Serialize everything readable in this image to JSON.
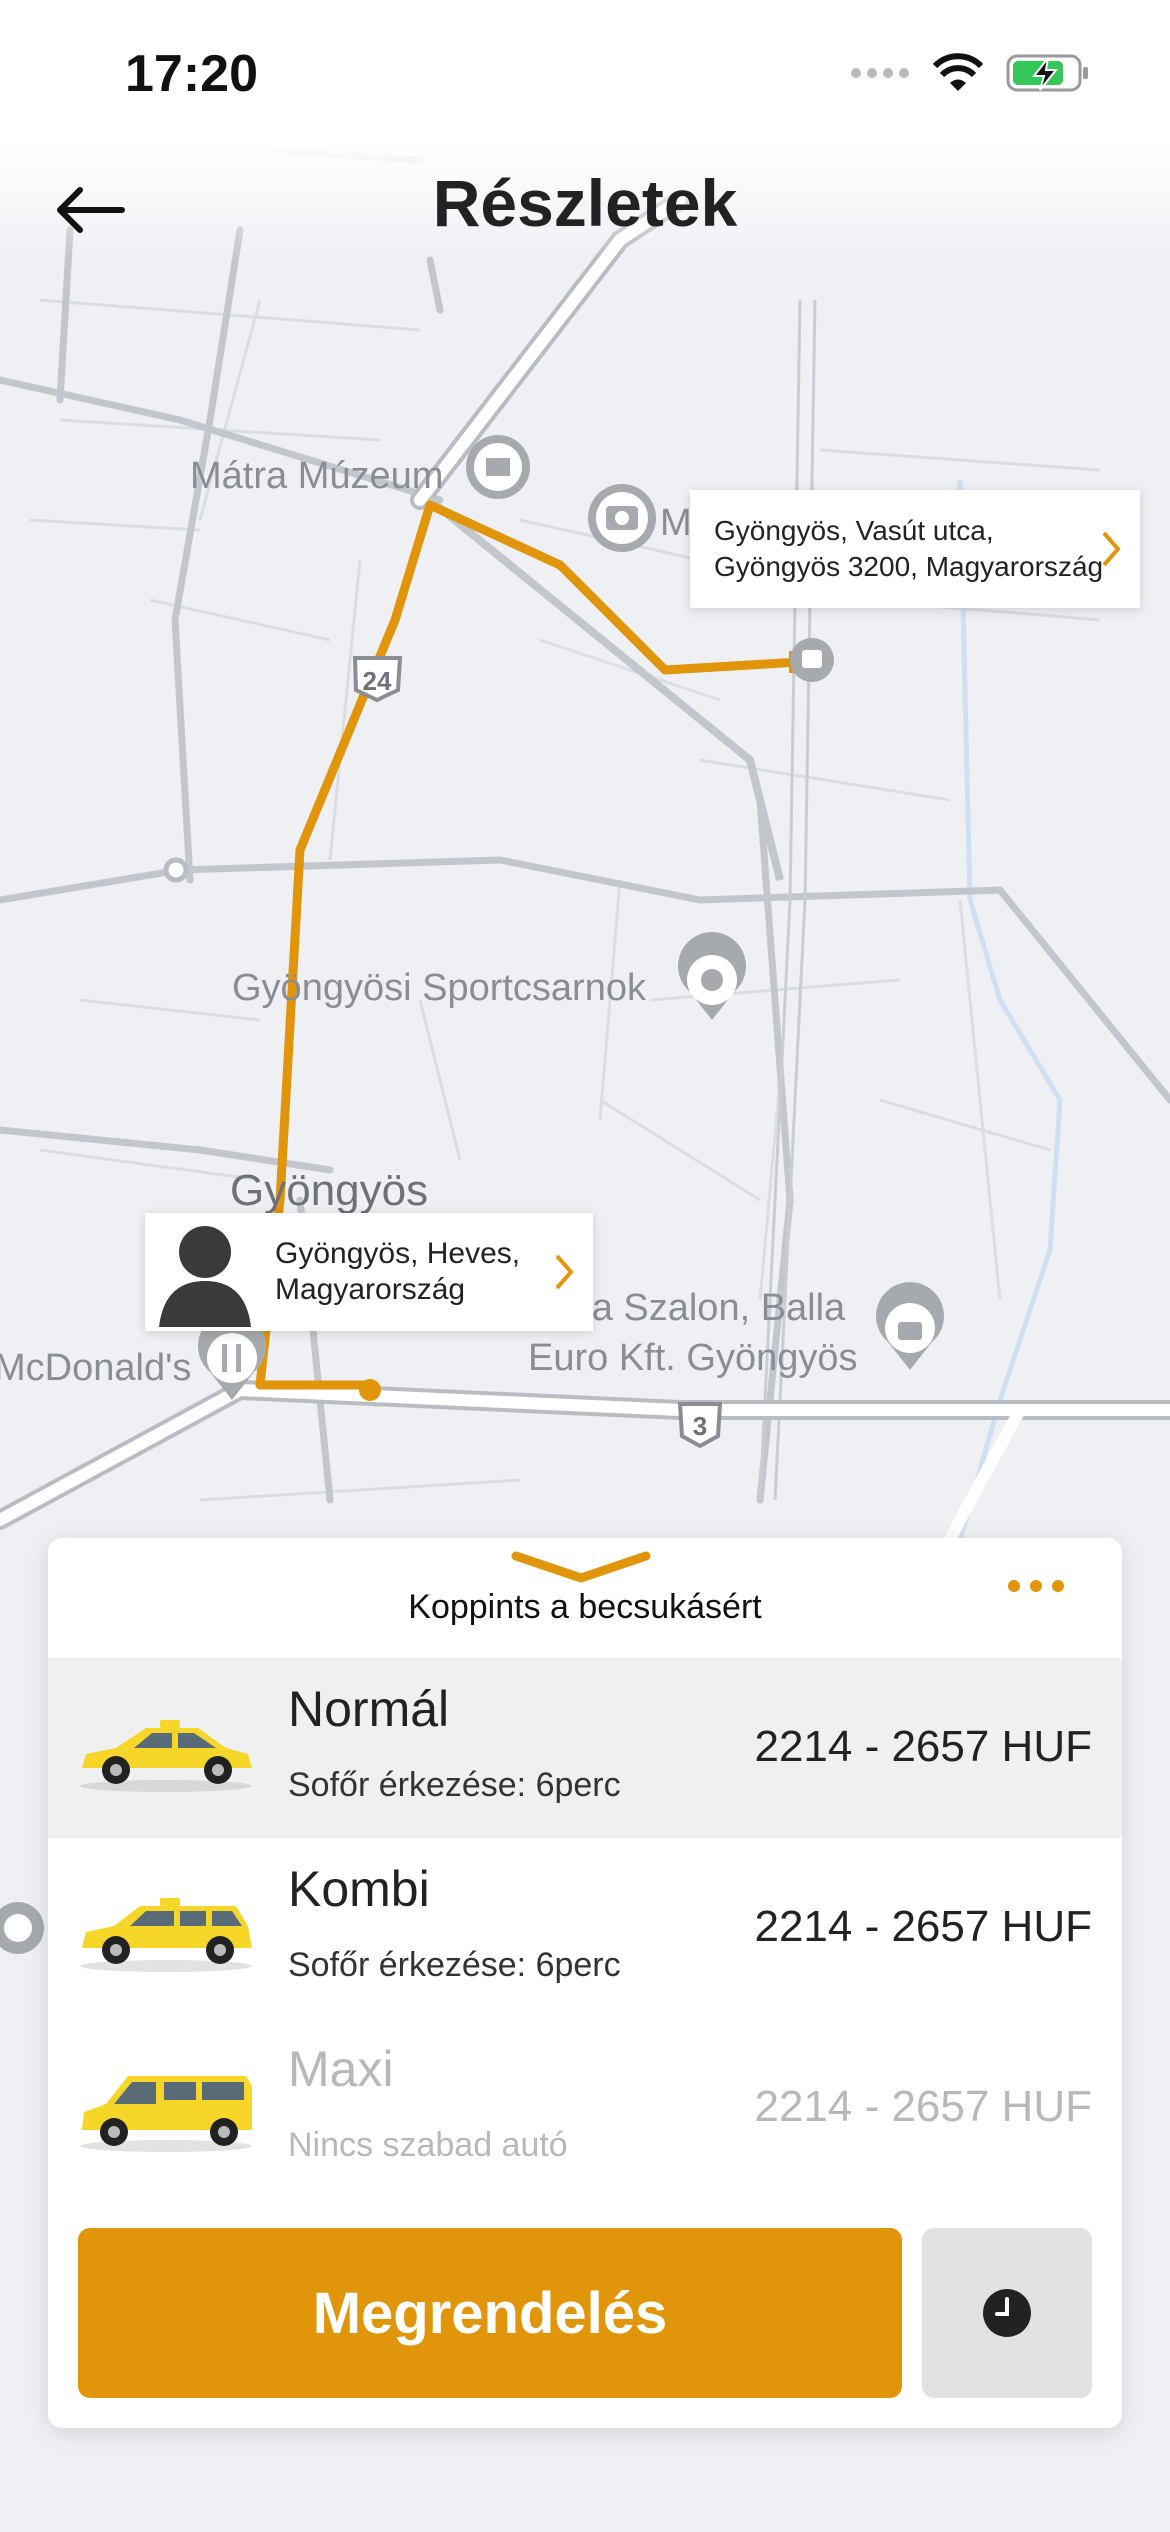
{
  "status_bar": {
    "time": "17:20",
    "battery": "charging"
  },
  "header": {
    "title": "Részletek",
    "back_icon": "arrow-left-icon"
  },
  "map": {
    "labels": {
      "museum": "Mátra Múzeum",
      "museum_cut": "M",
      "sports_hall": "Gyöngyösi Sportcsarnok",
      "town": "Gyöngyös",
      "shop_line1": "ota Szalon, Balla",
      "shop_line2": "Euro Kft. Gyöngyös",
      "mcdonalds": "McDonald's",
      "road_24": "24",
      "road_3": "3"
    },
    "route_color": "#e0950a"
  },
  "destination": {
    "line1": "Gyöngyös, Vasút utca,",
    "line2": "Gyöngyös 3200, Magyarország"
  },
  "pickup": {
    "line1": "Gyöngyös, Heves,",
    "line2": "Magyarország"
  },
  "sheet": {
    "hint": "Koppints a becsukásért",
    "options": [
      {
        "name": "Normál",
        "sub": "Sofőr érkezése: 6perc",
        "price": "2214 - 2657 HUF",
        "selected": true,
        "available": true
      },
      {
        "name": "Kombi",
        "sub": "Sofőr érkezése: 6perc",
        "price": "2214 - 2657 HUF",
        "selected": false,
        "available": true
      },
      {
        "name": "Maxi",
        "sub": "Nincs szabad autó",
        "price": "2214 - 2657 HUF",
        "selected": false,
        "available": false
      }
    ],
    "order_label": "Megrendelés",
    "accent": "#e0950a"
  }
}
